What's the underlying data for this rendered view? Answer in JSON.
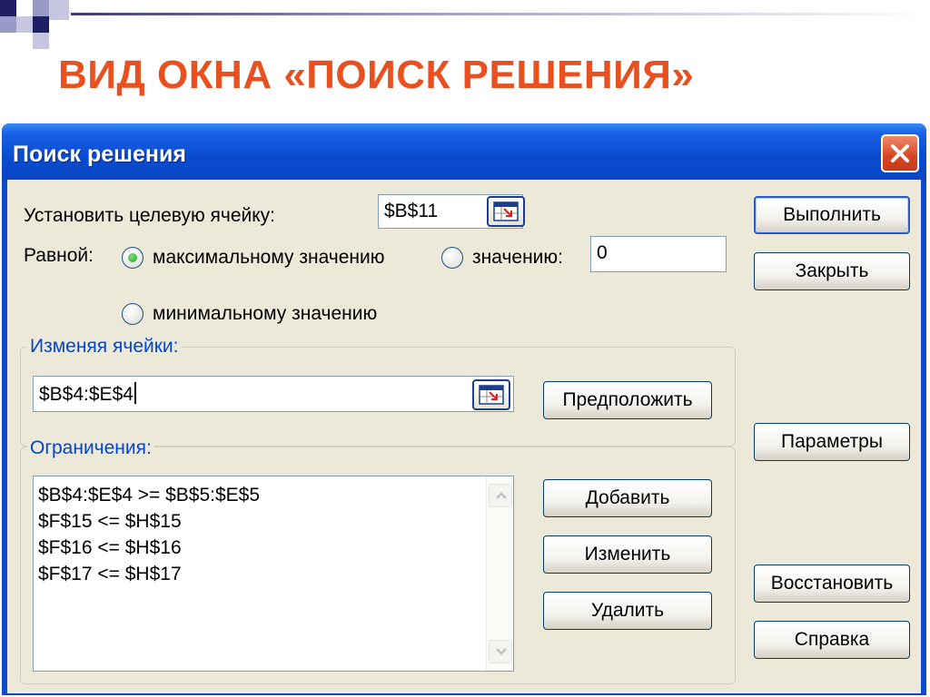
{
  "slide": {
    "title": "ВИД ОКНА «ПОИСК РЕШЕНИЯ»"
  },
  "dialog": {
    "title": "Поиск решения",
    "target_cell_label": "Установить целевую ячейку:",
    "target_cell_value": "$B$11",
    "equal_label": "Равной:",
    "radio_max_label": "максимальному значению",
    "radio_value_label": "значению:",
    "value_field": "0",
    "radio_min_label": "минимальному значению",
    "selected_option": "max",
    "changing_group_label": "Изменяя ячейки:",
    "changing_value": "$B$4:$E$4",
    "guess_button": "Предположить",
    "constraints_group_label": "Ограничения:",
    "constraints": [
      "$B$4:$E$4 >= $B$5:$E$5",
      "$F$15 <= $H$15",
      "$F$16 <= $H$16",
      "$F$17 <= $H$17"
    ],
    "add_button": "Добавить",
    "change_button": "Изменить",
    "delete_button": "Удалить",
    "solve_button": "Выполнить",
    "close_button": "Закрыть",
    "options_button": "Параметры",
    "reset_button": "Восстановить",
    "help_button": "Справка"
  },
  "icons": {
    "window_close": "close-icon",
    "cell_reference": "collapse-dialog-icon",
    "scroll_up": "scroll-up-icon",
    "scroll_down": "scroll-down-icon"
  },
  "colors": {
    "slide_title": "#e8501f",
    "title_bar": "#0a4bd0",
    "dialog_face": "#ece9d8",
    "group_label": "#0046d5"
  }
}
